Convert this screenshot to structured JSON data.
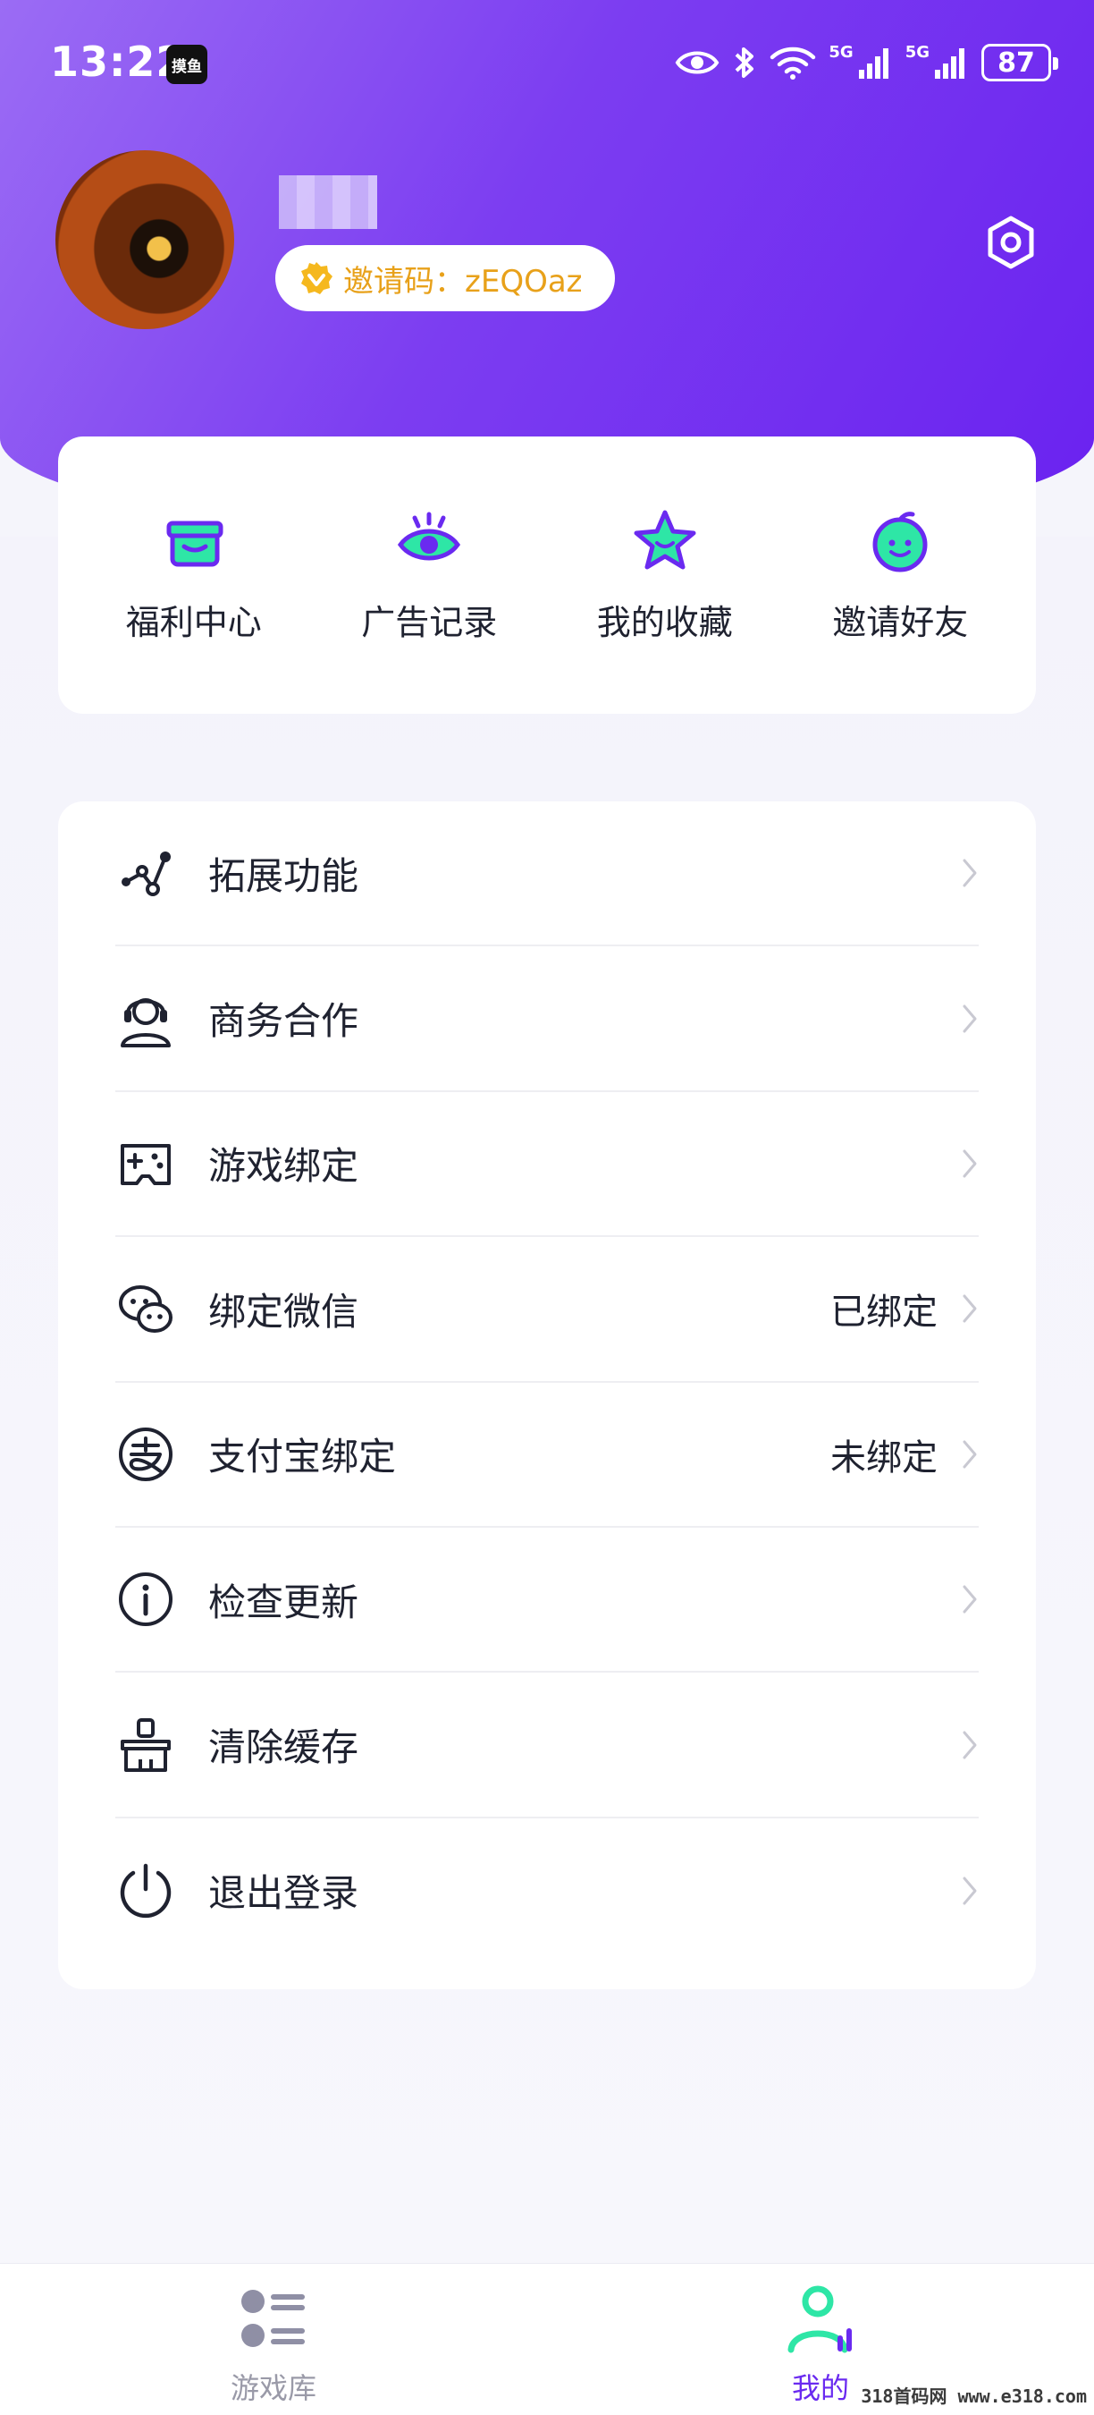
{
  "status_bar": {
    "time": "13:22",
    "app_badge": "摸鱼",
    "network_1": "5G",
    "network_2": "5G",
    "battery": "87"
  },
  "profile": {
    "invite_code_text": "邀请码：zEQOaz"
  },
  "quick_actions": [
    {
      "label": "福利中心",
      "icon": "gift-icon"
    },
    {
      "label": "广告记录",
      "icon": "eye-icon"
    },
    {
      "label": "我的收藏",
      "icon": "star-icon"
    },
    {
      "label": "邀请好友",
      "icon": "smile-face-icon"
    }
  ],
  "menu": [
    {
      "label": "拓展功能",
      "value": "",
      "icon": "nodes-icon"
    },
    {
      "label": "商务合作",
      "value": "",
      "icon": "headset-icon"
    },
    {
      "label": "游戏绑定",
      "value": "",
      "icon": "gamepad-icon"
    },
    {
      "label": "绑定微信",
      "value": "已绑定",
      "icon": "wechat-icon"
    },
    {
      "label": "支付宝绑定",
      "value": "未绑定",
      "icon": "alipay-icon"
    },
    {
      "label": "检查更新",
      "value": "",
      "icon": "info-icon"
    },
    {
      "label": "清除缓存",
      "value": "",
      "icon": "broom-icon"
    },
    {
      "label": "退出登录",
      "value": "",
      "icon": "power-icon"
    }
  ],
  "bottom_nav": {
    "games_label": "游戏库",
    "mine_label": "我的"
  },
  "watermark": "318首码网 www.e318.com",
  "colors": {
    "header_gradient_start": "#9b6cf4",
    "header_gradient_end": "#6a22f0",
    "accent_green": "#2ee6a6",
    "accent_purple": "#6a2af0",
    "invite_text": "#e8a11a"
  }
}
